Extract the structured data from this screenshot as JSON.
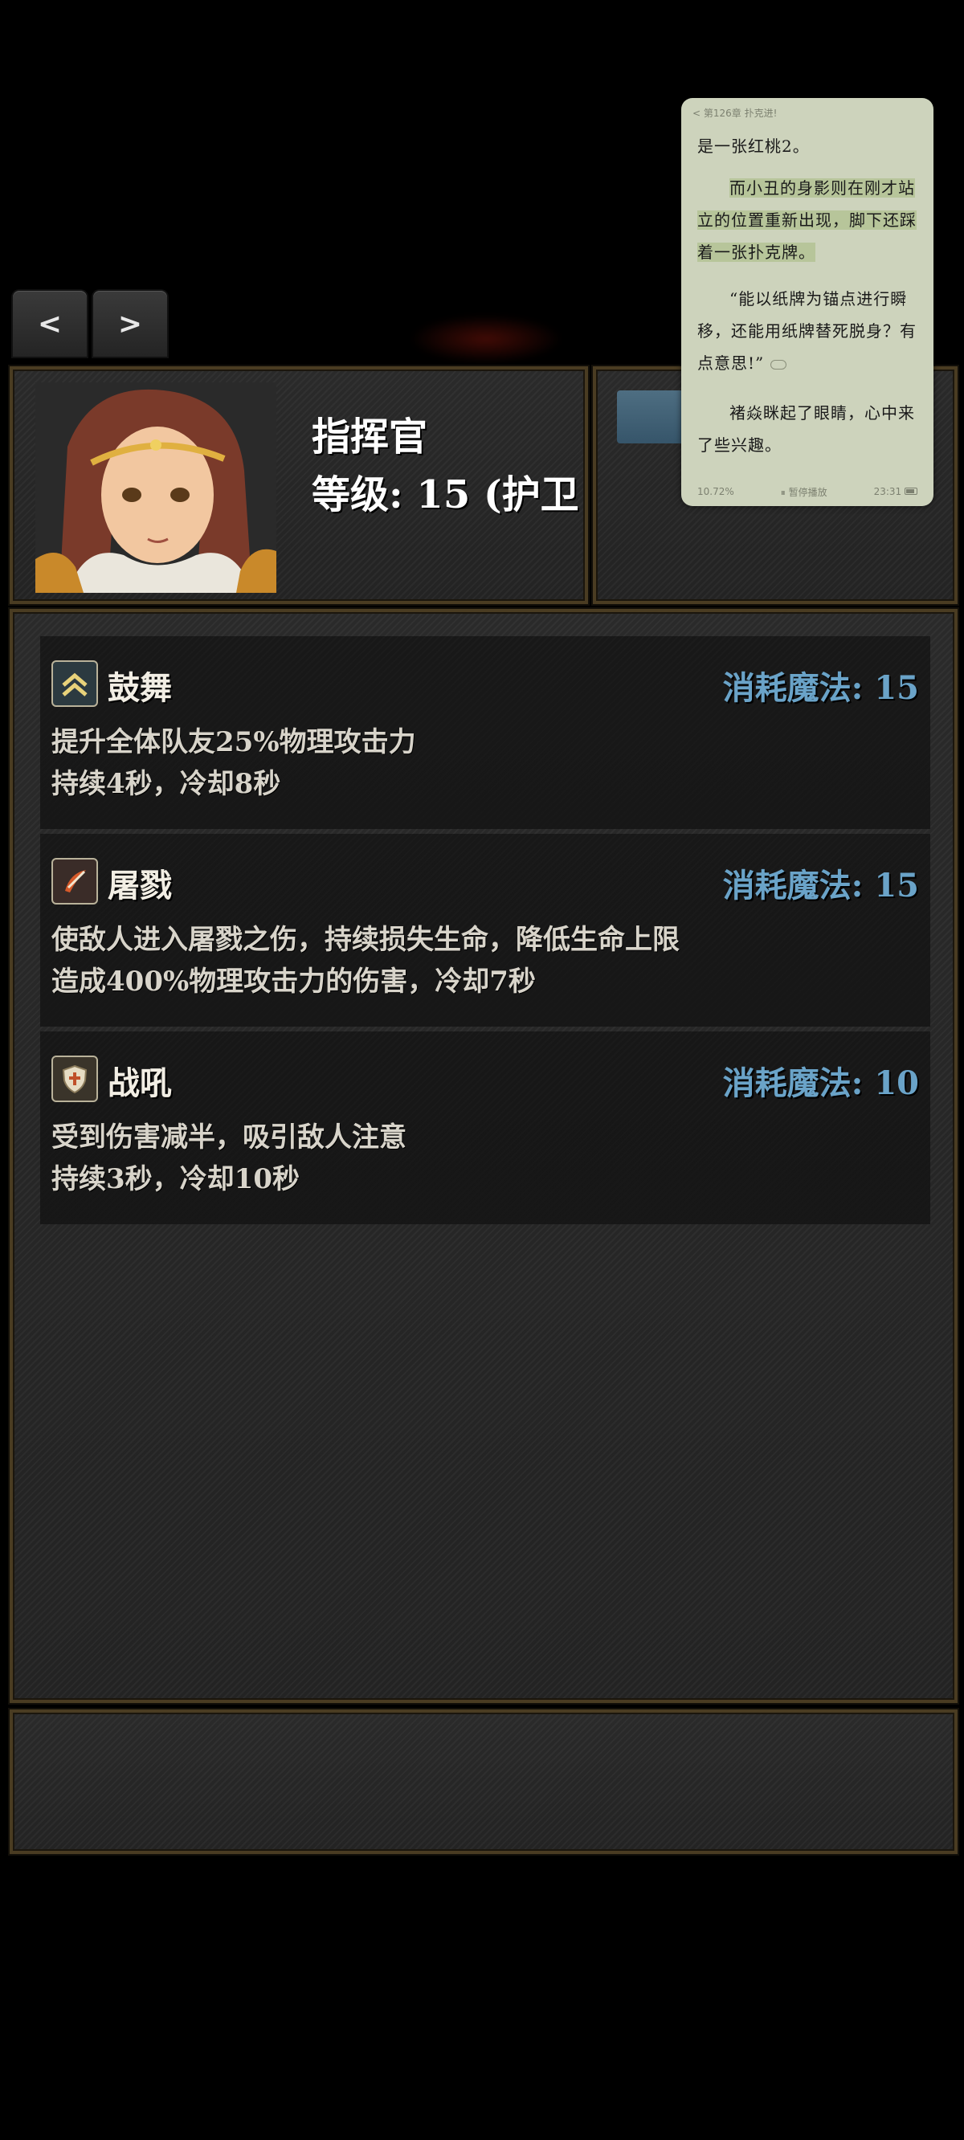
{
  "nav": {
    "prev": "<",
    "next": ">"
  },
  "hero": {
    "name": "指挥官",
    "level": "等级: 15 (护卫"
  },
  "skills": [
    {
      "name": "鼓舞",
      "icon": "double-chevron-up-icon",
      "cost": "消耗魔法: 15",
      "desc": [
        "提升全体队友25%物理攻击力",
        "持续4秒，冷却8秒"
      ]
    },
    {
      "name": "屠戮",
      "icon": "blade-slash-icon",
      "cost": "消耗魔法: 15",
      "desc": [
        "使敌人进入屠戮之伤，持续损失生命，降低生命上限",
        "造成400%物理攻击力的伤害，冷却7秒"
      ]
    },
    {
      "name": "战吼",
      "icon": "cross-shield-icon",
      "cost": "消耗魔法: 10",
      "desc": [
        "受到伤害减半，吸引敌人注意",
        "持续3秒，冷却10秒"
      ]
    }
  ],
  "reader": {
    "chapter": "< 第126章 扑克进!",
    "p1": "是一张红桃2。",
    "p2": "而小丑的身影则在刚才站立的位置重新出现，脚下还踩着一张扑克牌。",
    "p3": "“能以纸牌为锚点进行瞬移，还能用纸牌替死脱身？有点意思!”",
    "p4": "褚焱眯起了眼睛，心中来了些兴趣。",
    "progress": "10.72%",
    "pause": "⏸ 暂停播放",
    "time": "23:31"
  },
  "colors": {
    "cost": "#6aa3c8",
    "frame": "#4a3c22",
    "reader_bg": "#cdd3bc"
  }
}
